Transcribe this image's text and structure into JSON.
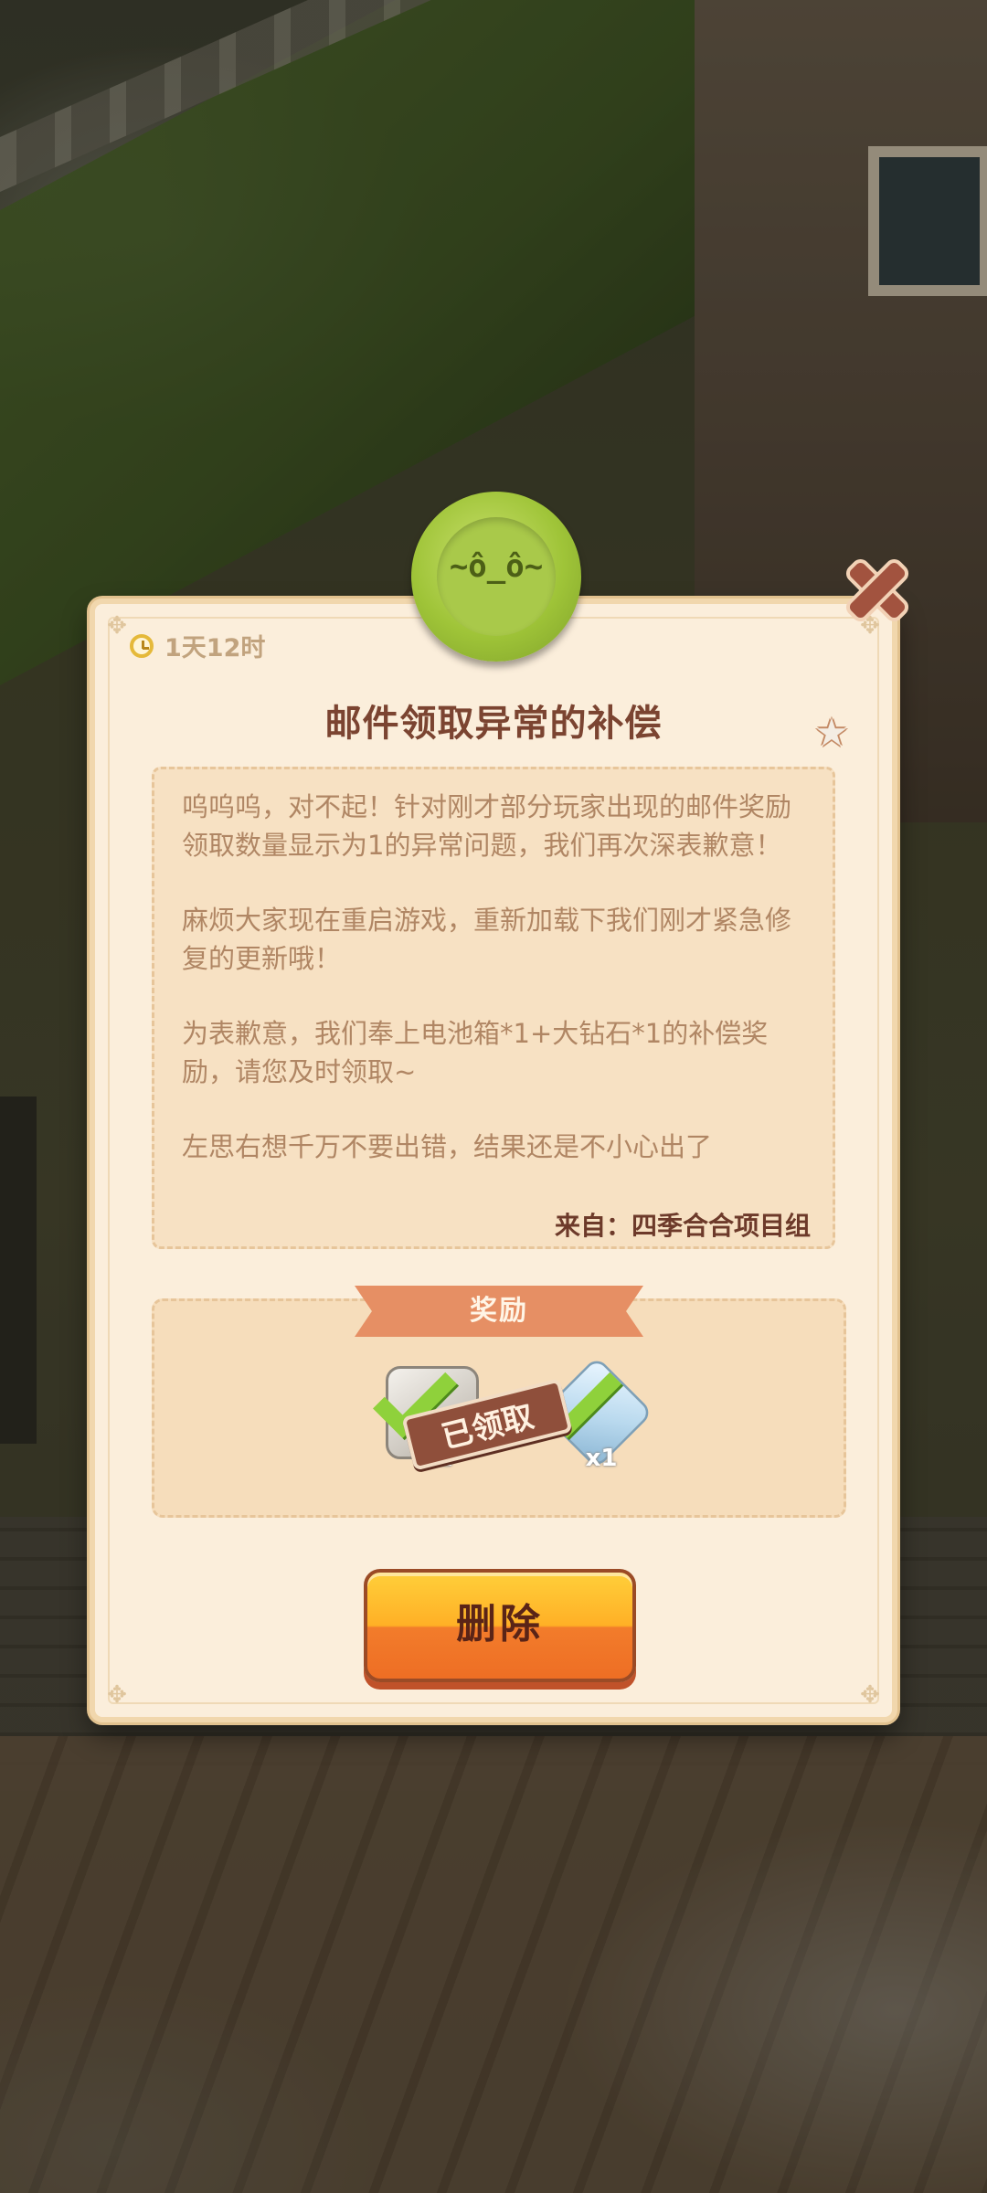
{
  "mail": {
    "timer": "1天12时",
    "title": "邮件领取异常的补偿",
    "body": [
      "呜呜呜，对不起！针对刚才部分玩家出现的邮件奖励领取数量显示为1的异常问题，我们再次深表歉意！",
      "麻烦大家现在重启游戏，重新加载下我们刚才紧急修复的更新哦！",
      "为表歉意，我们奉上电池箱*1+大钻石*1的补偿奖励，请您及时领取~",
      "左思右想千万不要出错，结果还是不小心出了"
    ],
    "from": "来自：四季合合项目组"
  },
  "reward": {
    "banner": "奖励",
    "items": [
      {
        "icon": "battery-box-icon",
        "qty": "x1",
        "claimed": true
      },
      {
        "icon": "big-diamond-icon",
        "qty": "x1",
        "claimed": true
      }
    ],
    "claimed_label": "已领取"
  },
  "actions": {
    "delete_label": "删除"
  },
  "seal": {
    "face": "~ô_ô~"
  },
  "colors": {
    "panel_bg": "#fbeedb",
    "title": "#7b4431",
    "body_text": "#b08664",
    "banner": "#e68f64",
    "button_orange": "#ffb026",
    "seal_green": "#9fc438",
    "close": "#a2533f"
  }
}
